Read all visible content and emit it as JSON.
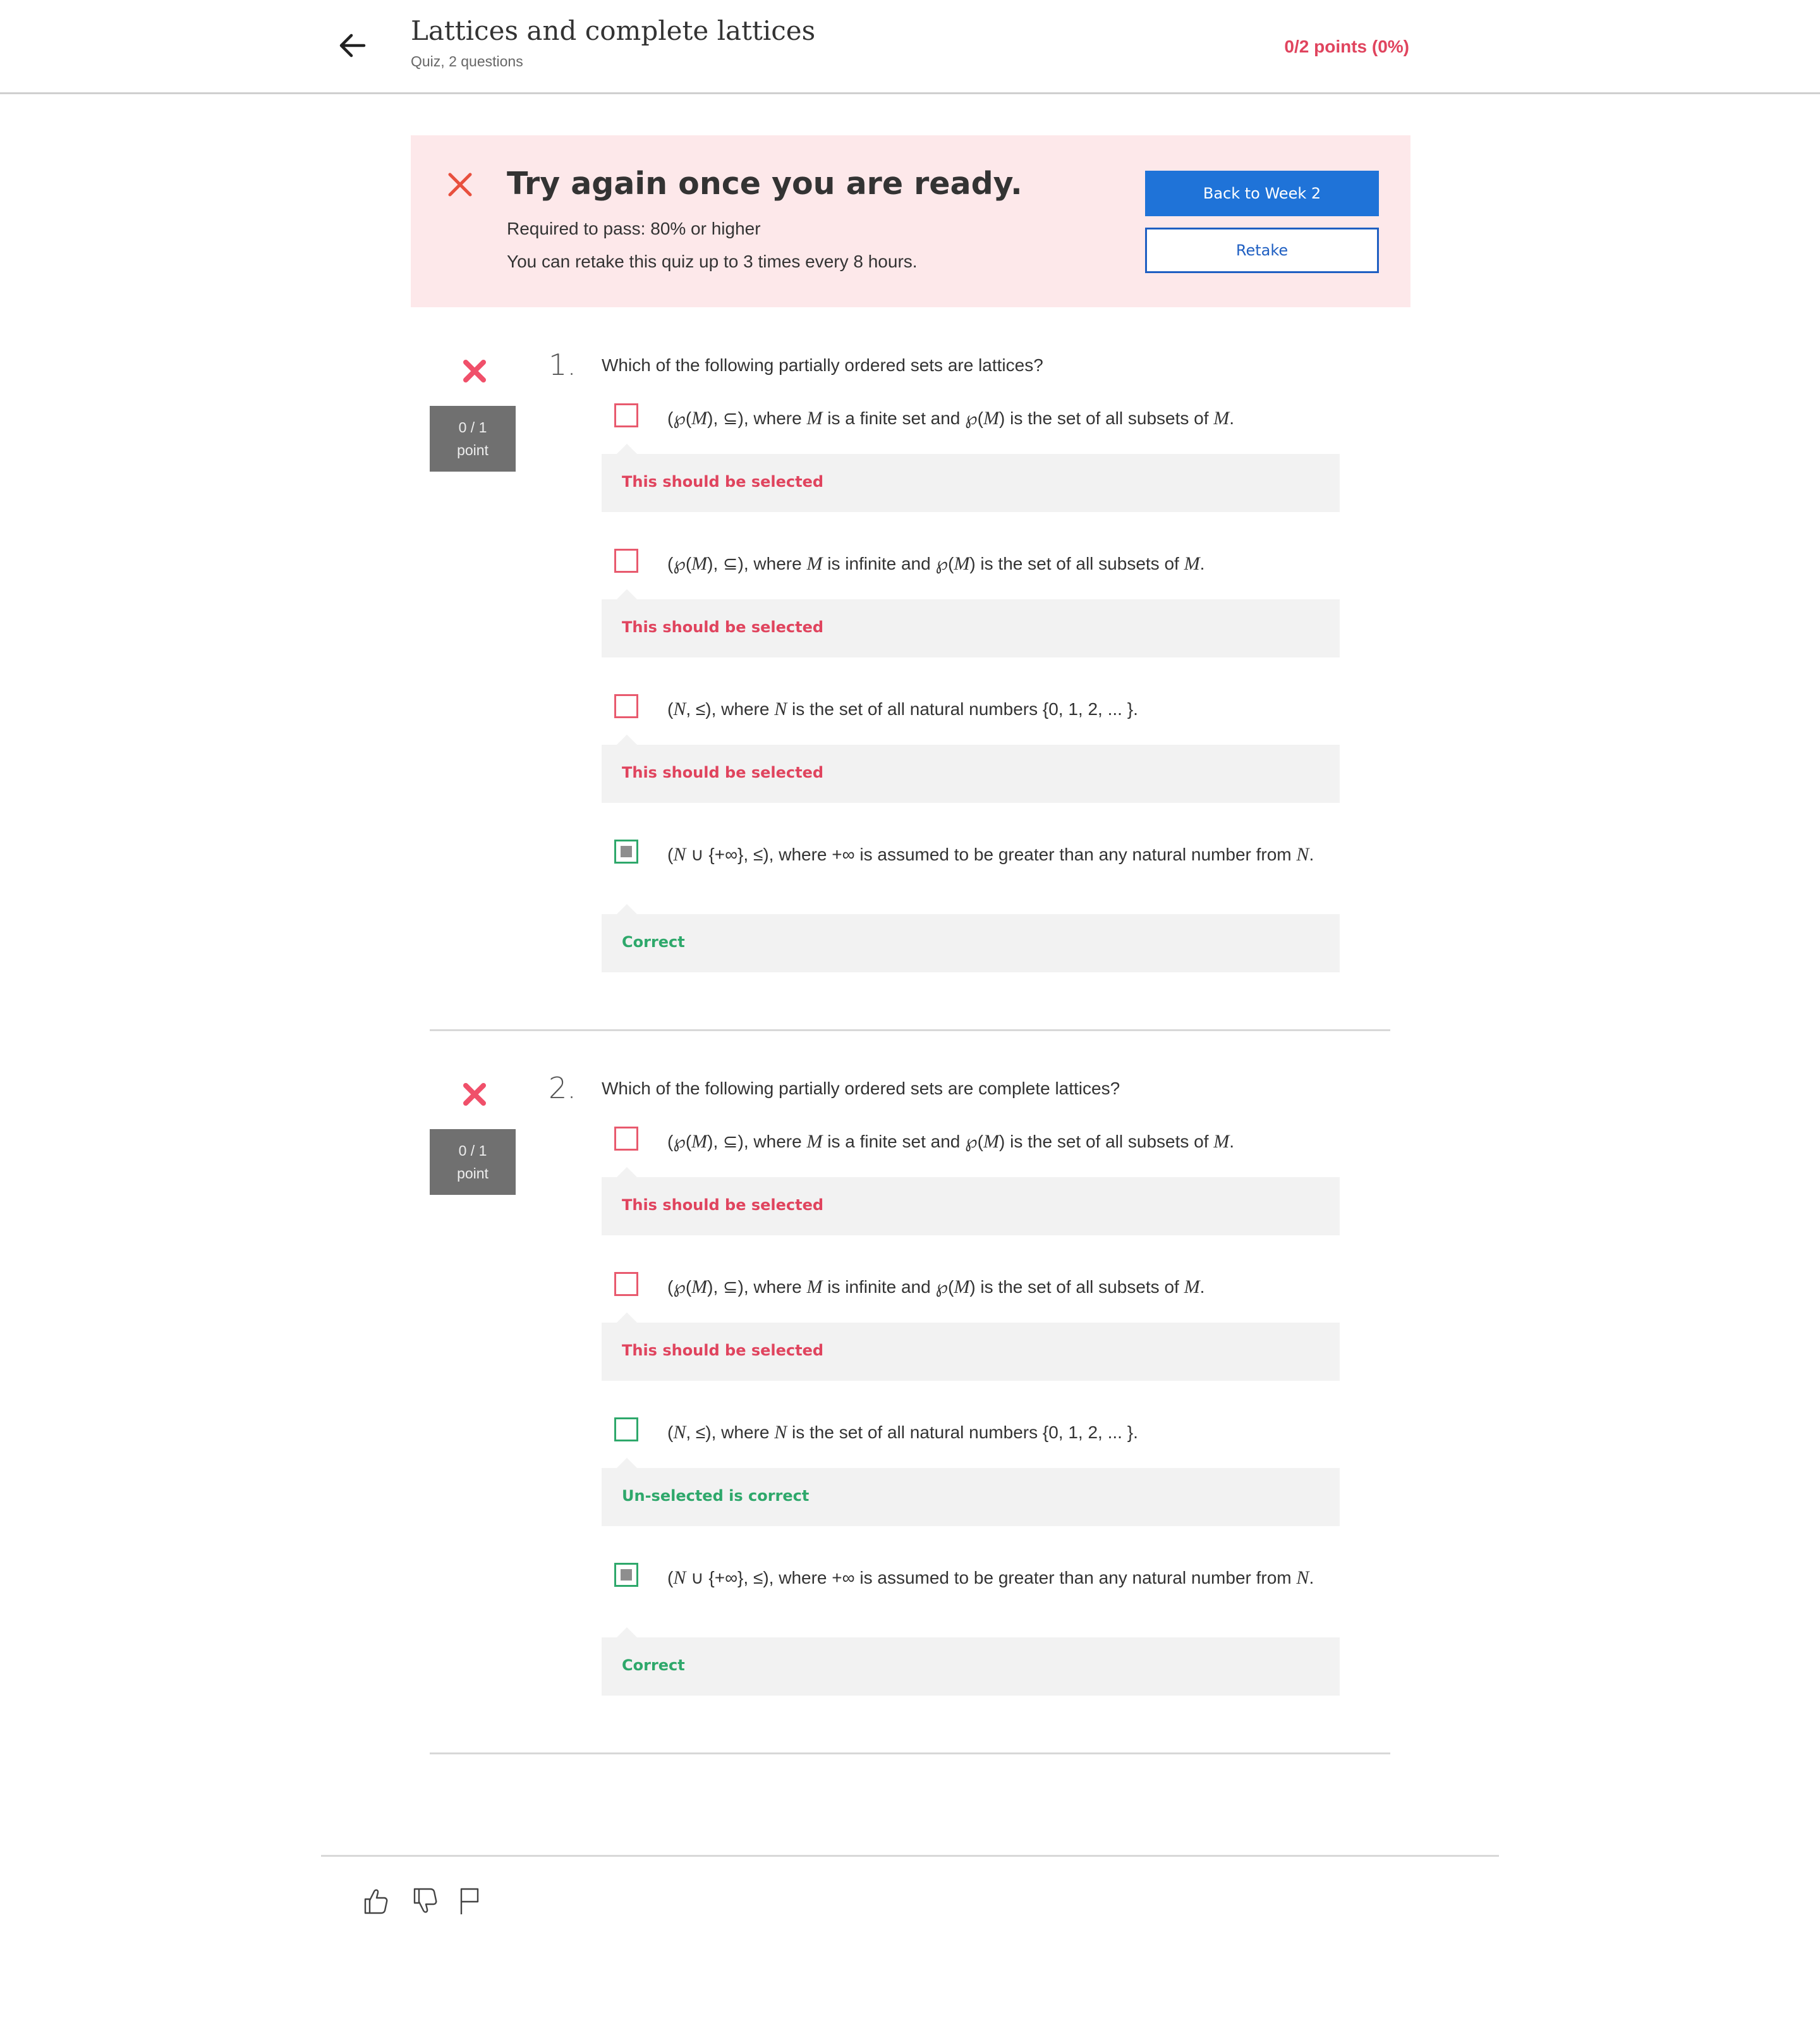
{
  "header": {
    "title": "Lattices and complete lattices",
    "subtitle": "Quiz, 2 questions",
    "points": "0/2 points (0%)",
    "back_icon": "arrow-left-icon"
  },
  "banner": {
    "heading": "Try again once you are ready.",
    "line1": "Required to pass: 80% or higher",
    "line2": "You can retake this quiz up to 3 times every 8 hours.",
    "primary_button": "Back to Week 2",
    "secondary_button": "Retake",
    "accent": "#1f73d8",
    "bg": "#fde8ea"
  },
  "questions": [
    {
      "number": "1.",
      "text": "Which of the following partially ordered sets are lattices?",
      "score_line1": "0 / 1",
      "score_line2": "point",
      "options": [
        {
          "checked": false,
          "feedback": "This should be selected",
          "feedback_status": "error"
        },
        {
          "checked": false,
          "feedback": "This should be selected",
          "feedback_status": "error"
        },
        {
          "checked": false,
          "feedback": "This should be selected",
          "feedback_status": "error"
        },
        {
          "checked": true,
          "feedback": "Correct",
          "feedback_status": "correct"
        }
      ]
    },
    {
      "number": "2.",
      "text": "Which of the following partially ordered sets are complete lattices?",
      "score_line1": "0 / 1",
      "score_line2": "point",
      "options": [
        {
          "checked": false,
          "feedback": "This should be selected",
          "feedback_status": "error"
        },
        {
          "checked": false,
          "feedback": "This should be selected",
          "feedback_status": "error"
        },
        {
          "checked": false,
          "feedback": "Un-selected is correct",
          "feedback_status": "correct"
        },
        {
          "checked": true,
          "feedback": "Correct",
          "feedback_status": "correct"
        }
      ]
    }
  ],
  "option_texts": {
    "where": ", where",
    "finite": "is a finite set and",
    "infinite": "is infinite and",
    "all_subsets": "is the set of all subsets of",
    "natural": "is the set of all natural numbers {0, 1, 2, ... }.",
    "greater": "is assumed to be greater than any natural number from"
  },
  "footer": {
    "like_icon": "thumbs-up-icon",
    "dislike_icon": "thumbs-down-icon",
    "flag_icon": "flag-icon"
  },
  "colors": {
    "error": "#e0445e",
    "correct": "#2ea86b",
    "primary": "#1f73d8"
  }
}
